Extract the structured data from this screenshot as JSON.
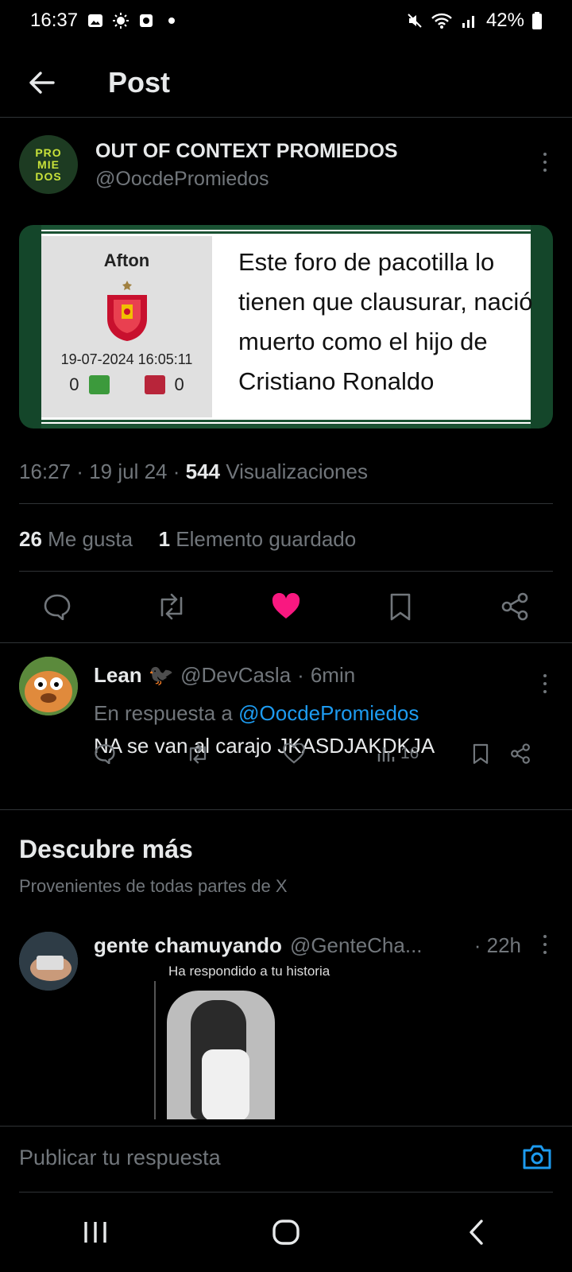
{
  "status_bar": {
    "time": "16:37",
    "battery": "42%"
  },
  "header": {
    "title": "Post"
  },
  "post": {
    "author_name": "OUT OF CONTEXT PROMIEDOS",
    "author_handle": "@OocdePromiedos",
    "avatar_text": [
      "PRO",
      "MIE",
      "DOS"
    ],
    "media": {
      "username": "Afton",
      "date": "19-07-2024 16:05:11",
      "likes": "0",
      "dislikes": "0",
      "quote": "Este foro de pacotilla lo tienen que clausurar, nació muerto como el hijo de Cristiano Ronaldo"
    },
    "time": "16:27",
    "date": "19 jul 24",
    "views_count": "544",
    "views_label": "Visualizaciones",
    "likes_count": "26",
    "likes_label": "Me gusta",
    "bookmarks_count": "1",
    "bookmarks_label": "Elemento guardado",
    "liked": true
  },
  "reply": {
    "name": "Lean",
    "emoji": "🐦‍⬛",
    "handle": "@DevCasla",
    "age": "6min",
    "in_reply_prefix": "En respuesta a",
    "in_reply_handle": "@OocdePromiedos",
    "text": "NA se van al carajo JKASDJAKDKJA",
    "views": "16"
  },
  "discover": {
    "title": "Descubre más",
    "subtitle": "Provenientes de todas partes de X"
  },
  "feed_post": {
    "name": "gente chamuyando",
    "handle": "@GenteCha...",
    "age": "· 22h",
    "image_caption": "Ha respondido a tu historia"
  },
  "composer": {
    "placeholder": "Publicar tu respuesta"
  },
  "colors": {
    "accent": "#1d9bf0",
    "like": "#f91880",
    "muted": "#71767b"
  }
}
